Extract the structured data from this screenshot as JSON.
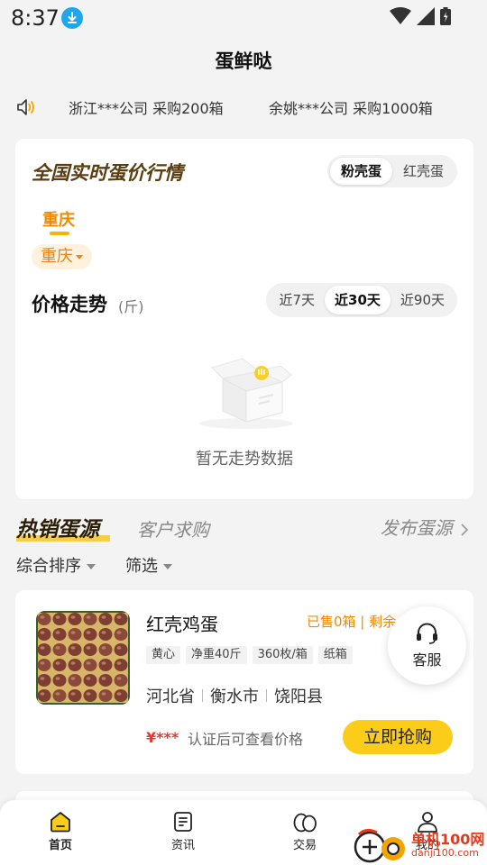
{
  "status_bar": {
    "time": "8:37"
  },
  "app": {
    "title": "蛋鲜哒"
  },
  "ticker": {
    "items": [
      "浙江***公司 采购200箱",
      "余姚***公司 采购1000箱"
    ]
  },
  "price_card": {
    "heading": "全国实时蛋价行情",
    "egg_types": [
      "粉壳蛋",
      "红壳蛋"
    ],
    "active_egg_type": "粉壳蛋",
    "region_tab": "重庆",
    "region_select": "重庆",
    "trend_title": "价格走势",
    "trend_unit": "(斤)",
    "ranges": [
      "近7天",
      "近30天",
      "近90天"
    ],
    "active_range": "近30天",
    "empty_text": "暂无走势数据"
  },
  "section_tabs": {
    "hot": "热销蛋源",
    "demand": "客户求购",
    "publish": "发布蛋源"
  },
  "sort_row": {
    "sort_label": "综合排序",
    "filter_label": "筛选"
  },
  "product": {
    "name": "红壳鸡蛋",
    "sold_status": "已售0箱 | 剩余",
    "tags": [
      "黄心",
      "净重40斤",
      "360枚/箱",
      "纸箱"
    ],
    "province": "河北省",
    "city": "衡水市",
    "county": "饶阳县",
    "price_mask": "¥***",
    "price_hint": "认证后可查看价格",
    "buy_label": "立即抢购"
  },
  "service": {
    "label": "客服"
  },
  "bottom_nav": {
    "items": [
      {
        "label": "首页",
        "icon": "home-icon"
      },
      {
        "label": "资讯",
        "icon": "news-icon"
      },
      {
        "label": "交易",
        "icon": "eggs-icon"
      },
      {
        "label": "我的",
        "icon": "profile-icon"
      }
    ],
    "active": "首页"
  },
  "watermark": {
    "text": "单机100网",
    "sub": "danji100.com"
  },
  "colors": {
    "accent_yellow": "#fccc1a",
    "accent_orange": "#f08a00",
    "price_red": "#e53935",
    "background": "#f3f3f3"
  }
}
